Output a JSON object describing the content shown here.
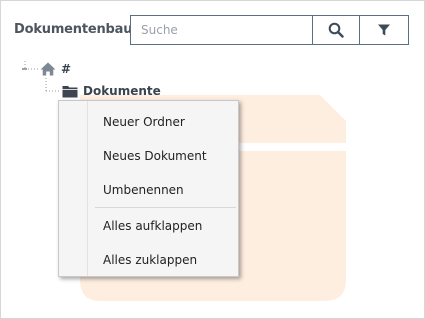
{
  "header": {
    "title": "Dokumentenbaum",
    "search_placeholder": "Suche",
    "search_value": "",
    "search_icon": "search-icon",
    "filter_icon": "filter-icon"
  },
  "tree": {
    "root": {
      "label": "#",
      "icon": "home-icon"
    },
    "child": {
      "label": "Dokumente",
      "icon": "folder-icon"
    }
  },
  "context_menu": {
    "items": [
      {
        "label": "Neuer Ordner"
      },
      {
        "label": "Neues Dokument"
      },
      {
        "label": "Umbenennen"
      },
      {
        "label": "Alles aufklappen"
      },
      {
        "label": "Alles zuklappen"
      }
    ]
  },
  "colors": {
    "accent": "#5c6e84",
    "watermark": "#fdeee0",
    "icon": "#7d8894"
  }
}
